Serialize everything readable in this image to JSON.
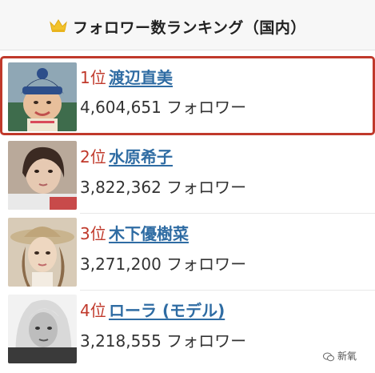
{
  "header": {
    "title": "フォロワー数ランキング（国内）",
    "icon": "crown-icon",
    "icon_color": "#f2c22b"
  },
  "accent_colors": {
    "rank": "#c0392b",
    "name_link": "#2f6ca3",
    "highlight_border": "#c0392b"
  },
  "rankings": [
    {
      "rank": "1位",
      "name": "渡辺直美",
      "followers": "4,604,651 フォロワー"
    },
    {
      "rank": "2位",
      "name": "水原希子",
      "followers": "3,822,362 フォロワー"
    },
    {
      "rank": "3位",
      "name": "木下優樹菜",
      "followers": "3,271,200 フォロワー"
    },
    {
      "rank": "4位",
      "name": "ローラ (モデル)",
      "followers": "3,218,555 フォロワー"
    }
  ],
  "watermark": {
    "text": "新氧",
    "icon": "wechat-icon"
  }
}
